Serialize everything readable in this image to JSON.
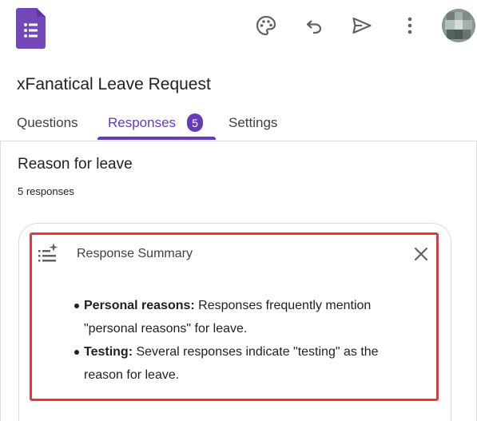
{
  "app": {
    "logo_icon": "google-forms-icon",
    "brand_color": "#673ab7"
  },
  "toolbar": {
    "icons": [
      "palette-icon",
      "undo-icon",
      "send-icon",
      "more-vert-icon"
    ],
    "avatar_icon": "user-avatar"
  },
  "form": {
    "title": "xFanatical Leave Request"
  },
  "tabs": [
    {
      "label": "Questions",
      "active": false
    },
    {
      "label": "Responses",
      "active": true,
      "badge": "5"
    },
    {
      "label": "Settings",
      "active": false
    }
  ],
  "question": {
    "title": "Reason for leave",
    "response_count": "5 responses"
  },
  "summary": {
    "heading": "Response Summary",
    "icon": "ai-summary-icon",
    "highlight_color": "#e0393e",
    "items": [
      {
        "term": "Personal reasons:",
        "text": " Responses frequently mention \"personal reasons\" for leave."
      },
      {
        "term": "Testing:",
        "text": " Several responses indicate \"testing\" as the reason for leave."
      }
    ]
  }
}
